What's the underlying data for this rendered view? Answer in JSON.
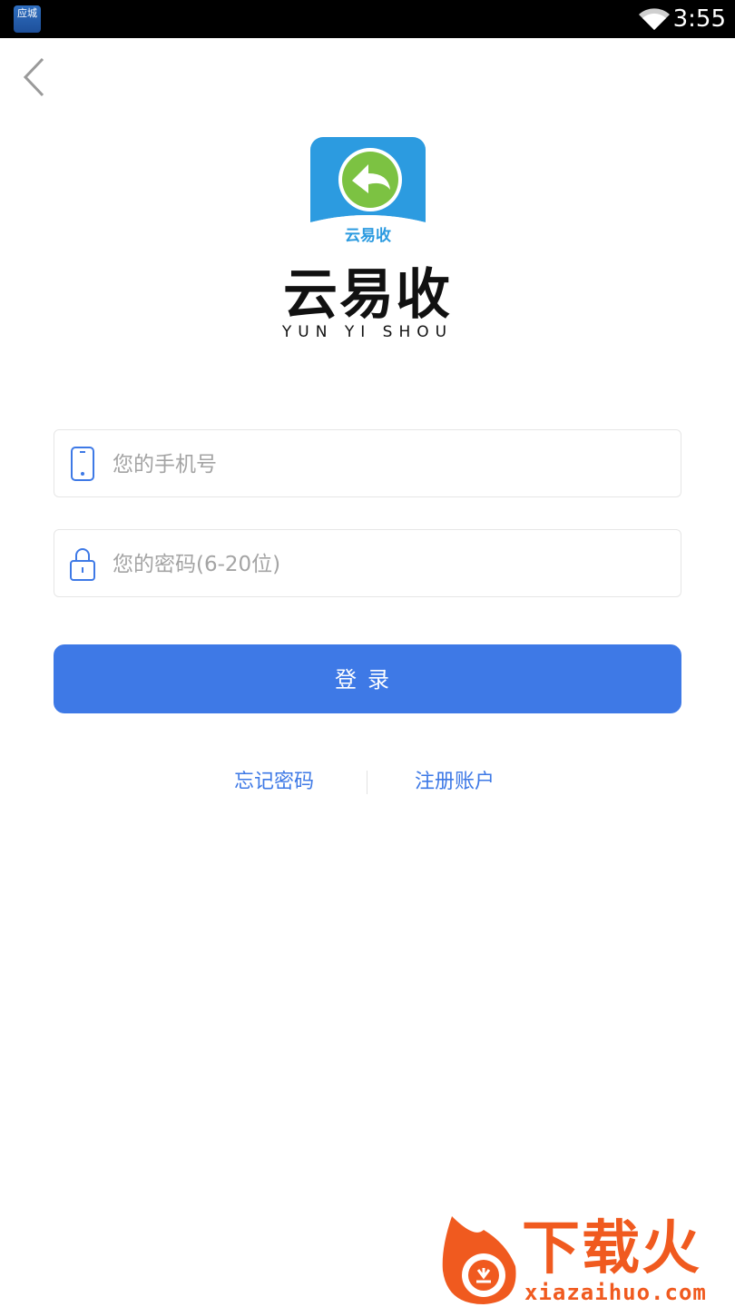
{
  "status_bar": {
    "notification_app_label": "应城",
    "time": "3:55"
  },
  "logo": {
    "caption": "云易收",
    "brand_name": "云易收",
    "brand_pinyin": "YUN YI SHOU"
  },
  "form": {
    "phone_placeholder": "您的手机号",
    "password_placeholder": "您的密码(6-20位)",
    "login_label": "登录"
  },
  "links": {
    "forgot_password": "忘记密码",
    "register": "注册账户"
  },
  "watermark": {
    "text": "下载火",
    "url": "xiazaihuo.com"
  },
  "colors": {
    "primary": "#3e79e6",
    "logo_blue": "#2c9be0",
    "logo_green": "#7cc242",
    "watermark_orange": "#f05a1f"
  },
  "icons": {
    "back": "chevron-left-icon",
    "phone": "phone-icon",
    "lock": "lock-icon",
    "wifi": "wifi-icon"
  }
}
